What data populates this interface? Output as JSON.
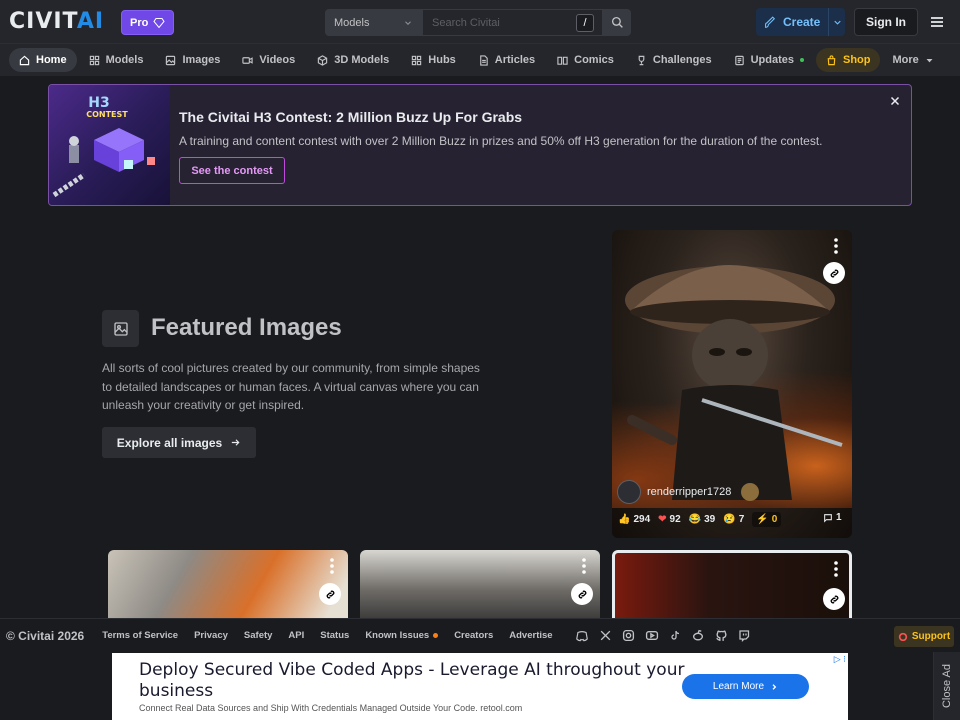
{
  "header": {
    "logo_main": "CIVIT",
    "logo_accent": "AI",
    "pro_label": "Pro",
    "search_scope": "Models",
    "search_placeholder": "Search Civitai",
    "search_shortcut": "/",
    "create_label": "Create",
    "signin_label": "Sign In"
  },
  "nav": {
    "items": [
      {
        "label": "Home",
        "icon": "home-icon"
      },
      {
        "label": "Models",
        "icon": "grid-icon"
      },
      {
        "label": "Images",
        "icon": "photo-icon"
      },
      {
        "label": "Videos",
        "icon": "video-icon"
      },
      {
        "label": "3D Models",
        "icon": "cube-icon"
      },
      {
        "label": "Hubs",
        "icon": "grid-icon"
      },
      {
        "label": "Articles",
        "icon": "file-icon"
      },
      {
        "label": "Comics",
        "icon": "book-icon"
      },
      {
        "label": "Challenges",
        "icon": "trophy-icon"
      },
      {
        "label": "Updates",
        "icon": "news-icon"
      },
      {
        "label": "Shop",
        "icon": "bag-icon"
      },
      {
        "label": "More",
        "icon": "caret-down-icon"
      }
    ]
  },
  "banner": {
    "title": "The Civitai H3 Contest: 2 Million Buzz Up For Grabs",
    "description": "A training and content contest with over 2 Million Buzz in prizes and 50% off H3 generation for the duration of the contest.",
    "cta_label": "See the contest",
    "art_text_1": "H3",
    "art_text_2": "CONTEST"
  },
  "featured": {
    "title": "Featured Images",
    "description": "All sorts of cool pictures created by our community, from simple shapes to detailed landscapes or human faces. A virtual canvas where you can unleash your creativity or get inspired.",
    "cta_label": "Explore all images"
  },
  "main_card": {
    "username": "renderripper1728",
    "reactions": {
      "like": "294",
      "heart": "92",
      "laugh": "39",
      "cry": "7",
      "buzz": "0",
      "comments": "1"
    }
  },
  "footer": {
    "copyright": "© Civitai 2026",
    "links": [
      "Terms of Service",
      "Privacy",
      "Safety",
      "API",
      "Status",
      "Known Issues",
      "Creators",
      "Advertise"
    ],
    "social_icons": [
      "discord-icon",
      "x-icon",
      "instagram-icon",
      "youtube-icon",
      "tiktok-icon",
      "reddit-icon",
      "github-icon",
      "twitch-icon"
    ],
    "support_label": "Support"
  },
  "ad": {
    "headline": "Deploy Secured Vibe Coded Apps - Leverage AI throughout your business",
    "subline": "Connect Real Data Sources and Ship With Credentials Managed Outside Your Code. retool.com",
    "button_label": "Learn More",
    "close_label": "Close Ad"
  },
  "colors": {
    "background": "#1a1b1e",
    "header": "#25262b",
    "accent_blue": "#228be6",
    "pro_purple": "#7048e8",
    "shop_yellow": "#fcc419"
  }
}
